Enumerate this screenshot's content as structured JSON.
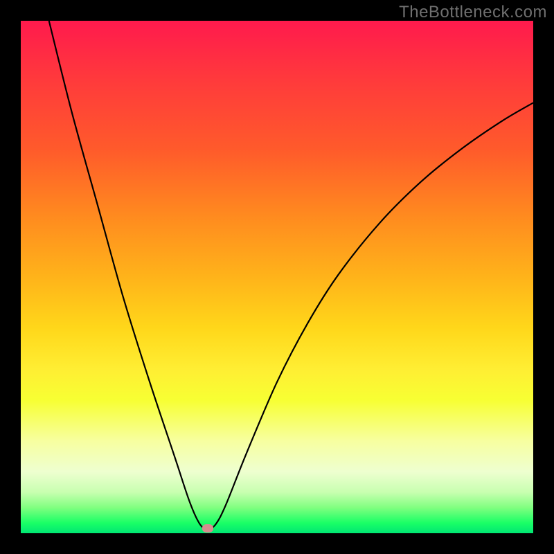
{
  "watermark": "TheBottleneck.com",
  "marker": {
    "x_pct": 36.5,
    "y_pct": 99.0
  },
  "colors": {
    "curve_stroke": "#000000",
    "watermark_color": "#6f6f6f",
    "marker_color": "#d48e8e",
    "frame_bg": "#000000"
  },
  "chart_data": {
    "type": "line",
    "title": "",
    "xlabel": "",
    "ylabel": "",
    "xlim_pct": [
      0,
      100
    ],
    "ylim_pct": [
      0,
      100
    ],
    "grid": false,
    "legend": false,
    "series": [
      {
        "name": "bottleneck-curve",
        "comment": "V-shaped curve. y is percentage from top (0=top, 100=bottom). x is percentage from left.",
        "points": [
          {
            "x": 5.5,
            "y": 0.0
          },
          {
            "x": 10.0,
            "y": 18.0
          },
          {
            "x": 15.0,
            "y": 36.0
          },
          {
            "x": 20.0,
            "y": 54.0
          },
          {
            "x": 25.0,
            "y": 70.0
          },
          {
            "x": 30.0,
            "y": 85.0
          },
          {
            "x": 33.0,
            "y": 94.0
          },
          {
            "x": 35.0,
            "y": 98.3
          },
          {
            "x": 36.5,
            "y": 99.1
          },
          {
            "x": 38.0,
            "y": 98.3
          },
          {
            "x": 40.0,
            "y": 94.5
          },
          {
            "x": 44.0,
            "y": 84.5
          },
          {
            "x": 50.0,
            "y": 70.5
          },
          {
            "x": 56.0,
            "y": 59.0
          },
          {
            "x": 62.0,
            "y": 49.5
          },
          {
            "x": 70.0,
            "y": 39.5
          },
          {
            "x": 78.0,
            "y": 31.5
          },
          {
            "x": 86.0,
            "y": 25.0
          },
          {
            "x": 94.0,
            "y": 19.5
          },
          {
            "x": 100.0,
            "y": 16.0
          }
        ]
      }
    ],
    "marker_point": {
      "x_pct": 36.5,
      "y_pct": 99.0
    }
  }
}
